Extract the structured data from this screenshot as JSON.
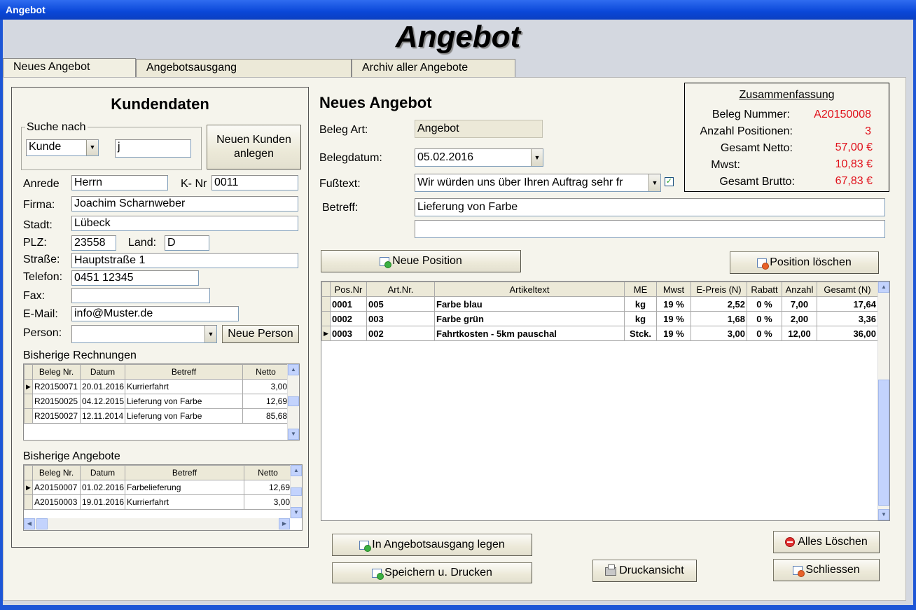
{
  "window": {
    "title": "Angebot"
  },
  "header": {
    "title": "Angebot"
  },
  "tabs": [
    {
      "label": "Neues Angebot"
    },
    {
      "label": "Angebotsausgang"
    },
    {
      "label": "Archiv aller Angebote"
    }
  ],
  "kunde": {
    "heading": "Kundendaten",
    "search": {
      "group_label": "Suche nach",
      "field": "Kunde",
      "value": "j"
    },
    "new_customer_button": [
      "Neuen Kunden",
      "anlegen"
    ],
    "labels": {
      "anrede": "Anrede",
      "knr": "K- Nr",
      "firma": "Firma:",
      "stadt": "Stadt:",
      "plz": "PLZ:",
      "land": "Land:",
      "strasse": "Straße:",
      "telefon": "Telefon:",
      "fax": "Fax:",
      "email": "E-Mail:",
      "person": "Person:"
    },
    "values": {
      "anrede": "Herrn",
      "knr": "0011",
      "firma": "Joachim Scharnweber",
      "stadt": "Lübeck",
      "plz": "23558",
      "land": "D",
      "strasse": "Hauptstraße 1",
      "telefon": "0451 12345",
      "fax": "",
      "email": "info@Muster.de",
      "person": ""
    },
    "new_person_button": "Neue Person"
  },
  "rechnungen": {
    "heading": "Bisherige Rechnungen",
    "columns": [
      "Beleg Nr.",
      "Datum",
      "Betreff",
      "Netto"
    ],
    "rows": [
      [
        "R20150071",
        "20.01.2016",
        "Kurrierfahrt",
        "3,00"
      ],
      [
        "R20150025",
        "04.12.2015",
        "Lieferung von Farbe",
        "12,69"
      ],
      [
        "R20150027",
        "12.11.2014",
        "Lieferung von Farbe",
        "85,68"
      ]
    ]
  },
  "angebote": {
    "heading": "Bisherige Angebote",
    "columns": [
      "Beleg Nr.",
      "Datum",
      "Betreff",
      "Netto"
    ],
    "rows": [
      [
        "A20150007",
        "01.02.2016",
        "Farbelieferung",
        "12,69"
      ],
      [
        "A20150003",
        "19.01.2016",
        "Kurrierfahrt",
        "3,00"
      ]
    ]
  },
  "form": {
    "heading": "Neues Angebot",
    "labels": {
      "belegart": "Beleg Art:",
      "belegdatum": "Belegdatum:",
      "fusstext": "Fußtext:",
      "betreff": "Betreff:"
    },
    "values": {
      "belegart": "Angebot",
      "belegdatum": "05.02.2016",
      "fusstext": "Wir würden uns über Ihren Auftrag sehr fr",
      "betreff1": "Lieferung von Farbe",
      "betreff2": ""
    },
    "fusstext_checked": "✓"
  },
  "summary": {
    "title": "Zusammenfassung",
    "rows": [
      {
        "label": "Beleg Nummer:",
        "value": "A20150008"
      },
      {
        "label": "Anzahl Positionen:",
        "value": "3"
      },
      {
        "label": "Gesamt Netto:",
        "value": "57,00 €"
      },
      {
        "label": "Mwst:",
        "value": "10,83 €"
      },
      {
        "label": "Gesamt Brutto:",
        "value": "67,83 €"
      }
    ]
  },
  "positions": {
    "new_button": "Neue Position",
    "delete_button": "Position löschen",
    "columns": [
      "Pos.Nr",
      "Art.Nr.",
      "Artikeltext",
      "ME",
      "Mwst",
      "E-Preis (N)",
      "Rabatt",
      "Anzahl",
      "Gesamt (N)"
    ],
    "rows": [
      [
        "0001",
        "005",
        "Farbe blau",
        "kg",
        "19 %",
        "2,52",
        "0 %",
        "7,00",
        "17,64"
      ],
      [
        "0002",
        "003",
        "Farbe grün",
        "kg",
        "19 %",
        "1,68",
        "0 %",
        "2,00",
        "3,36"
      ],
      [
        "0003",
        "002",
        "Fahrtkosten - 5km pauschal",
        "Stck.",
        "19 %",
        "3,00",
        "0 %",
        "12,00",
        "36,00"
      ]
    ]
  },
  "buttons": {
    "ausgang": "In Angebotsausgang legen",
    "speichern": "Speichern u. Drucken",
    "druckansicht": "Druckansicht",
    "alles_loeschen": "Alles Löschen",
    "schliessen": "Schliessen"
  },
  "colors": {
    "titlebar": "#1d56d6",
    "accent_red": "#e0101a"
  }
}
